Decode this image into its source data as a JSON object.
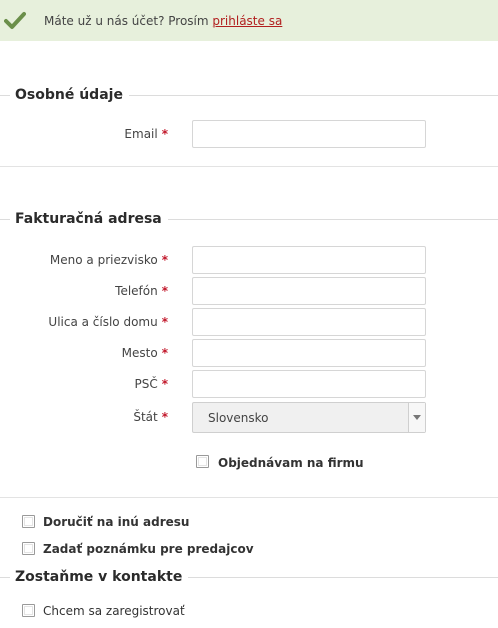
{
  "notice": {
    "text": "Máte už u nás účet? Prosím ",
    "link": "prihláste sa"
  },
  "personal": {
    "title": "Osobné údaje",
    "email_label": "Email",
    "required_mark": "*"
  },
  "billing": {
    "title": "Fakturačná adresa",
    "fields": {
      "name": "Meno a priezvisko",
      "phone": "Telefón",
      "street": "Ulica a číslo domu",
      "city": "Mesto",
      "zip": "PSČ",
      "country": "Štát"
    },
    "country_value": "Slovensko",
    "company_checkbox": "Objednávam na firmu"
  },
  "options": {
    "deliver_other": "Doručiť na inú adresu",
    "seller_note": "Zadať poznámku pre predajcov"
  },
  "contact": {
    "title": "Zostaňme v kontakte",
    "register": "Chcem sa zaregistrovať"
  }
}
